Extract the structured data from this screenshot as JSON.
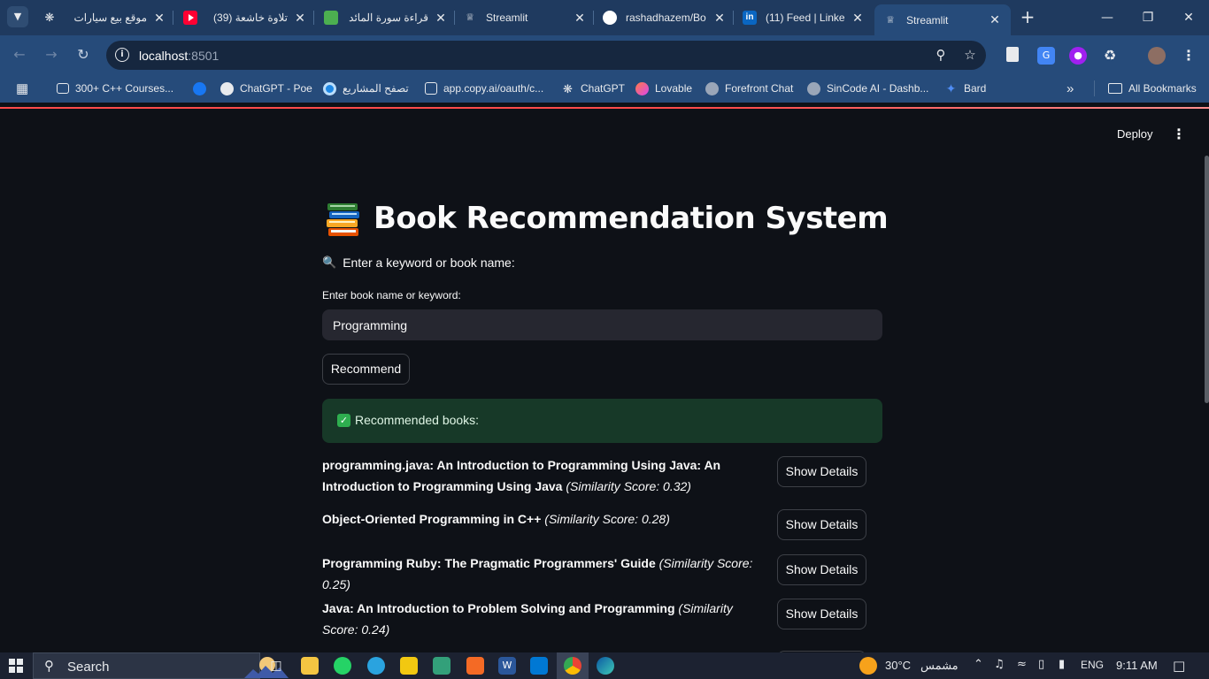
{
  "browser": {
    "tabs": [
      {
        "label": "موقع بيع سيارات",
        "favicon": "chatgpt-icon",
        "color": "#e8eaed"
      },
      {
        "label": "(39) تلاوة خاشعة",
        "favicon": "youtube-icon",
        "color": "#ff0033"
      },
      {
        "label": "قراءة سورة المائد",
        "favicon": "quran-icon",
        "color": "#4caf50"
      },
      {
        "label": "Streamlit",
        "favicon": "streamlit-icon",
        "color": "#ff4b4b"
      },
      {
        "label": "rashadhazem/Bo",
        "favicon": "github-icon",
        "color": "#ffffff"
      },
      {
        "label": "(11) Feed | Linke",
        "favicon": "linkedin-icon",
        "color": "#0a66c2"
      },
      {
        "label": "Streamlit",
        "favicon": "streamlit-icon",
        "color": "#ff4b4b",
        "active": true
      }
    ],
    "url_host": "localhost",
    "url_port": ":8501",
    "bookmarks": [
      {
        "label": "300+ C++ Courses...",
        "icon": "course-icon",
        "color": "#e8eaed"
      },
      {
        "label": "",
        "icon": "facebook-icon",
        "color": "#1877f2"
      },
      {
        "label": "ChatGPT - Poe",
        "icon": "poe-icon",
        "color": "#5d5cde"
      },
      {
        "label": "تصفح المشاريع",
        "icon": "projects-icon",
        "color": "#1e88e5"
      },
      {
        "label": "app.copy.ai/oauth/c...",
        "icon": "copyai-icon",
        "color": "#e8eaed"
      },
      {
        "label": "ChatGPT",
        "icon": "chatgpt-icon",
        "color": "#e8eaed"
      },
      {
        "label": "Lovable",
        "icon": "lovable-icon",
        "color": "#ff5c8a"
      },
      {
        "label": "Forefront Chat",
        "icon": "forefront-icon",
        "color": "#9aa6b8"
      },
      {
        "label": "SinCode AI - Dashb...",
        "icon": "sincode-icon",
        "color": "#9aa6b8"
      },
      {
        "label": "Bard",
        "icon": "bard-icon",
        "color": "#4f8df5"
      }
    ],
    "all_bookmarks": "All Bookmarks"
  },
  "app": {
    "deploy_label": "Deploy",
    "title": "Book Recommendation System",
    "title_icon": "books-icon",
    "subheader": "Enter a keyword or book name:",
    "input_label": "Enter book name or keyword:",
    "input_value": "Programming",
    "recommend_label": "Recommend",
    "success_text": "Recommended books:",
    "show_details_label": "Show Details",
    "recommendations": [
      {
        "title": "programming.java: An Introduction to Programming Using Java: An Introduction to Programming Using Java",
        "score": "(Similarity Score: 0.32)"
      },
      {
        "title": "Object-Oriented Programming in C++",
        "score": "(Similarity Score: 0.28)"
      },
      {
        "title": "Programming Ruby: The Pragmatic Programmers' Guide",
        "score": "(Similarity Score: 0.25)"
      },
      {
        "title": "Java: An Introduction to Problem Solving and Programming",
        "score": "(Similarity Score: 0.24)"
      }
    ]
  },
  "taskbar": {
    "search_label": "Search",
    "temperature": "30°C",
    "weather_text": "مشمس",
    "language": "ENG",
    "time": "9:11 AM"
  },
  "colors": {
    "app_bg": "#0e1117",
    "input_bg": "#262730",
    "success_bg": "#173928",
    "accent": "#ff4b4b",
    "chrome_frame": "#1f3a5f"
  }
}
